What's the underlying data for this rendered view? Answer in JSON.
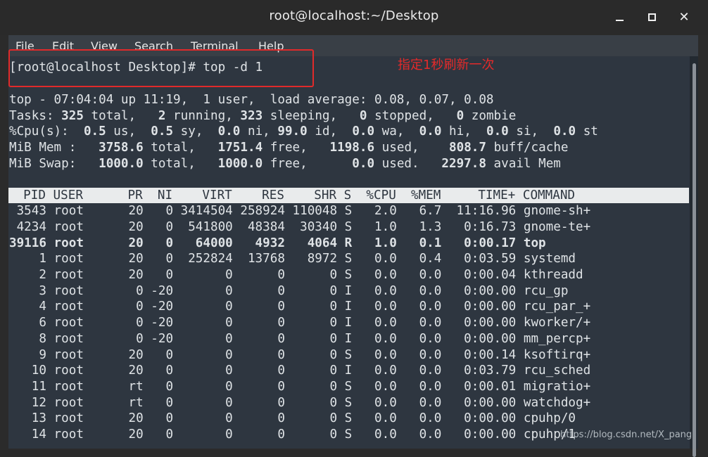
{
  "window": {
    "title": "root@localhost:~/Desktop",
    "close_symbol": "✕"
  },
  "menu": [
    "File",
    "Edit",
    "View",
    "Search",
    "Terminal",
    "Help"
  ],
  "terminal": {
    "prompt": "[root@localhost Desktop]# top -d 1",
    "summary": {
      "line1": "top - 07:04:04 up 11:19,  1 user,  load average: 0.08, 0.07, 0.08",
      "tasks": {
        "label": "Tasks: ",
        "total": "325",
        "t1": " total,   ",
        "running": "2",
        "t2": " running, ",
        "sleeping": "323",
        "t3": " sleeping,   ",
        "stopped": "0",
        "t4": " stopped,   ",
        "zombie": "0",
        "t5": " zombie"
      },
      "cpu": {
        "label": "%Cpu(s):  ",
        "us": "0.5",
        "t1": " us,  ",
        "sy": "0.5",
        "t2": " sy,  ",
        "ni": "0.0",
        "t3": " ni, ",
        "id": "99.0",
        "t4": " id,  ",
        "wa": "0.0",
        "t5": " wa,  ",
        "hi": "0.0",
        "t6": " hi,  ",
        "si": "0.0",
        "t7": " si,  ",
        "st": "0.0",
        "t8": " st"
      },
      "mem": {
        "label": "MiB Mem :   ",
        "total": "3758.6",
        "t1": " total,   ",
        "free": "1751.4",
        "t2": " free,   ",
        "used": "1198.6",
        "t3": " used,    ",
        "buff": "808.7",
        "t4": " buff/cache"
      },
      "swap": {
        "label": "MiB Swap:   ",
        "total": "1000.0",
        "t1": " total,   ",
        "free": "1000.0",
        "t2": " free,      ",
        "used": "0.0",
        "t3": " used.   ",
        "avail": "2297.8",
        "t4": " avail Mem"
      }
    },
    "table_header": "  PID USER      PR  NI    VIRT    RES    SHR S  %CPU  %MEM     TIME+ COMMAND",
    "rows": [
      " 3543 root      20   0 3414504 258924 110048 S   2.0   6.7  11:16.96 gnome-sh+",
      " 4234 root      20   0  541800  48384  30340 S   1.0   1.3   0:16.73 gnome-te+",
      "39116 root      20   0   64000   4932   4064 R   1.0   0.1   0:00.17 top",
      "    1 root      20   0  252824  13768   8972 S   0.0   0.4   0:03.59 systemd",
      "    2 root      20   0       0      0      0 S   0.0   0.0   0:00.04 kthreadd",
      "    3 root       0 -20       0      0      0 I   0.0   0.0   0:00.00 rcu_gp",
      "    4 root       0 -20       0      0      0 I   0.0   0.0   0:00.00 rcu_par_+",
      "    6 root       0 -20       0      0      0 I   0.0   0.0   0:00.00 kworker/+",
      "    8 root       0 -20       0      0      0 I   0.0   0.0   0:00.00 mm_percp+",
      "    9 root      20   0       0      0      0 S   0.0   0.0   0:00.14 ksoftirq+",
      "   10 root      20   0       0      0      0 I   0.0   0.0   0:03.79 rcu_sched",
      "   11 root      rt   0       0      0      0 S   0.0   0.0   0:00.01 migratio+",
      "   12 root      rt   0       0      0      0 S   0.0   0.0   0:00.00 watchdog+",
      "   13 root      20   0       0      0      0 S   0.0   0.0   0:00.00 cpuhp/0",
      "   14 root      20   0       0      0      0 S   0.0   0.0   0:00.00 cpuhp/1"
    ]
  },
  "annotation": {
    "text": "指定1秒刷新一次",
    "color": "#e42a2a"
  },
  "watermark": "https://blog.csdn.net/X_pang"
}
